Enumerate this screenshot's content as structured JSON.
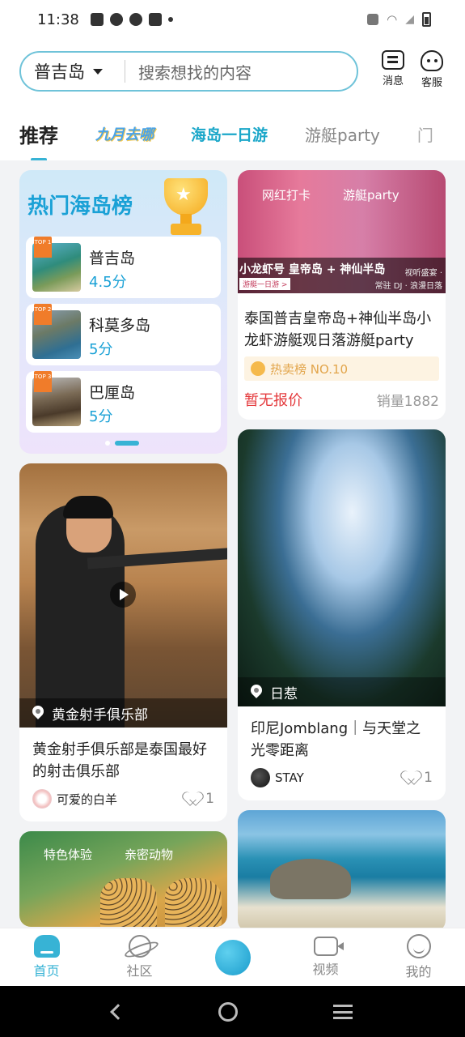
{
  "status_bar": {
    "time": "11:38"
  },
  "header": {
    "location": "普吉岛",
    "search_placeholder": "搜索想找的内容",
    "messages_label": "消息",
    "service_label": "客服"
  },
  "tabs": [
    {
      "label": "推荐"
    },
    {
      "label": "九月去哪"
    },
    {
      "label": "海岛一日游"
    },
    {
      "label": "游艇party"
    },
    {
      "label": "门"
    }
  ],
  "hot_list": {
    "title": "热门海岛榜",
    "items": [
      {
        "rank": "TOP 1",
        "name": "普吉岛",
        "score": "4.5分"
      },
      {
        "rank": "TOP 2",
        "name": "科莫多岛",
        "score": "5分"
      },
      {
        "rank": "TOP 3",
        "name": "巴厘岛",
        "score": "5分"
      }
    ]
  },
  "shooting_card": {
    "location": "黄金射手俱乐部",
    "title": "黄金射手俱乐部是泰国最好的射击俱乐部",
    "author": "可爱的白羊",
    "likes": "1"
  },
  "animals_card": {
    "tag_left": "特色体验",
    "tag_right": "亲密动物"
  },
  "party_card": {
    "overlay_left": "网红打卡",
    "overlay_right": "游艇party",
    "banner_text": "小龙虾号 皇帝岛 + 神仙半岛",
    "banner_sub_1": "视听盛宴 ·",
    "banner_sub_2": "常驻 DJ · 浪漫日落",
    "banner_tag": "游艇一日游 >",
    "title": "泰国普吉皇帝岛+神仙半岛小龙虾游艇观日落游艇party",
    "rank_tag": "热卖榜 NO.10",
    "price": "暂无报价",
    "sales": "销量1882"
  },
  "cave_card": {
    "location": "日惹",
    "title": "印尼Jomblang｜与天堂之光零距离",
    "author": "STAY",
    "likes": "1"
  },
  "bottom_nav": [
    {
      "label": "首页"
    },
    {
      "label": "社区"
    },
    {
      "label": ""
    },
    {
      "label": "视频"
    },
    {
      "label": "我的"
    }
  ],
  "colors": {
    "accent": "#37b3d5",
    "price": "#e4393c",
    "rank": "#e2a54b"
  }
}
